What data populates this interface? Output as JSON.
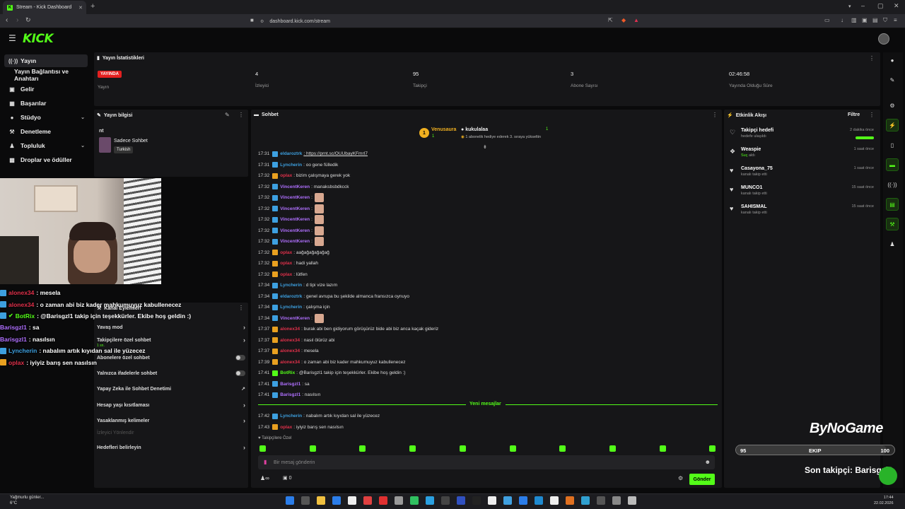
{
  "browser": {
    "tab_title": "Stream - Kick Dashboard",
    "url": "dashboard.kick.com/stream"
  },
  "app": {
    "logo": "KICK"
  },
  "nav": {
    "items": [
      {
        "label": "Yayın",
        "icon": "broadcast-icon"
      },
      {
        "label": "Yayın Bağlantısı ve Anahtarı",
        "icon": "link-icon"
      },
      {
        "label": "Gelir",
        "icon": "wallet-icon"
      },
      {
        "label": "Başarılar",
        "icon": "achievement-icon"
      },
      {
        "label": "Stüdyo",
        "icon": "studio-icon"
      },
      {
        "label": "Denetleme",
        "icon": "moderation-icon"
      },
      {
        "label": "Topluluk",
        "icon": "community-icon"
      },
      {
        "label": "Droplar ve ödüller",
        "icon": "gift-icon"
      }
    ]
  },
  "stats": {
    "title": "Yayın İstatistikleri",
    "live_badge": "YAYINDA",
    "items": [
      {
        "value": "",
        "label": "Yayın"
      },
      {
        "value": "4",
        "label": "İzleyici"
      },
      {
        "value": "95",
        "label": "Takipçi"
      },
      {
        "value": "3",
        "label": "Abone Sayısı"
      },
      {
        "value": "02:46:58",
        "label": "Yayında Olduğu Süre"
      }
    ]
  },
  "stream_info": {
    "title": "Yayın bilgisi",
    "stream_title": "nt",
    "category": "Sadece Sohbet",
    "language": "Turkish"
  },
  "overlay_chat": [
    {
      "user": "alonex34",
      "text": ": mesela",
      "color": "#e0304a"
    },
    {
      "user": "alonex34",
      "text": ": o zaman abi biz kader mahkumuyuz kabullenecez",
      "color": "#e0304a"
    },
    {
      "user": "BotRix",
      "text": ": @Barisgzl1 takip için teşekkürler. Ekibe hoş geldin :)",
      "color": "#53fc18"
    },
    {
      "user": "Barisgzl1",
      "text": ": sa",
      "color": "#b070ff"
    },
    {
      "user": "Barisgzl1",
      "text": ": nasılsın",
      "color": "#b070ff"
    },
    {
      "user": "Lyncherin",
      "text": ": nabalım artık kıyıdan sal ile yüzecez",
      "color": "#3da0e0"
    },
    {
      "user": "oplax",
      "text": ": iyiyiz barış sen nasılsın",
      "color": "#e0304a"
    }
  ],
  "channel_actions": {
    "title": "Kanal Eylemleri",
    "items": [
      {
        "label": "Yavaş mod",
        "control": "›"
      },
      {
        "label": "Takipçilere özel sohbet",
        "control": "›",
        "sub": "1 sn."
      },
      {
        "label": "Abonelere özel sohbet",
        "control": "toggle"
      },
      {
        "label": "Yalnızca ifadelerle sohbet",
        "control": "toggle"
      },
      {
        "label": "Yapay Zeka ile Sohbet Denetimi",
        "control": "↗"
      },
      {
        "label": "Hesap yaşı kısıtlaması",
        "control": "›"
      },
      {
        "label": "Yasaklanmış kelimeler",
        "control": "›"
      },
      {
        "label": "İzleyici Yönlendir",
        "control": ""
      },
      {
        "label": "Hedefleri belirleyin",
        "control": "›"
      }
    ]
  },
  "chat": {
    "title": "Sohbet",
    "pinned": {
      "user1": "Venusaura",
      "user1_count": "1",
      "user2": "kukulalaa",
      "user2_count": "1",
      "note": "1 abonelik hediye ederek 3. sıraya yükseltin"
    },
    "messages": [
      {
        "time": "17:31",
        "user": "eldaroztrk",
        "text": ": https://prnt.sc/OUUbayKFmrI7",
        "color": "#3da0e0"
      },
      {
        "time": "17:31",
        "user": "Lyncherin",
        "text": ": oo gene fülledik",
        "color": "#3da0e0"
      },
      {
        "time": "17:32",
        "user": "oplax",
        "text": ": bizim çalışmaya gerek yok",
        "color": "#e0304a"
      },
      {
        "time": "17:32",
        "user": "VincentKeren",
        "text": ": manaksbsbdkcck",
        "color": "#b070ff"
      },
      {
        "time": "17:32",
        "user": "VincentKeren",
        "text": ":",
        "color": "#b070ff",
        "emote": true
      },
      {
        "time": "17:32",
        "user": "VincentKeren",
        "text": ":",
        "color": "#b070ff",
        "emote": true
      },
      {
        "time": "17:32",
        "user": "VincentKeren",
        "text": ":",
        "color": "#b070ff",
        "emote": true
      },
      {
        "time": "17:32",
        "user": "VincentKeren",
        "text": ":",
        "color": "#b070ff",
        "emote": true
      },
      {
        "time": "17:32",
        "user": "VincentKeren",
        "text": ":",
        "color": "#b070ff",
        "emote": true
      },
      {
        "time": "17:32",
        "user": "oplax",
        "text": ": aağağağağağağ",
        "color": "#e0304a"
      },
      {
        "time": "17:32",
        "user": "oplax",
        "text": ": hadi yallah",
        "color": "#e0304a"
      },
      {
        "time": "17:32",
        "user": "oplax",
        "text": ": lütfen",
        "color": "#e0304a"
      },
      {
        "time": "17:34",
        "user": "Lyncherin",
        "text": ": d tipi vize lazım",
        "color": "#3da0e0"
      },
      {
        "time": "17:34",
        "user": "eldaroztrk",
        "text": ": genel avrupa bu şekilde almanca fransızca oynuyo",
        "color": "#3da0e0"
      },
      {
        "time": "17:34",
        "user": "Lyncherin",
        "text": ": çalışma için",
        "color": "#3da0e0"
      },
      {
        "time": "17:34",
        "user": "VincentKeren",
        "text": ":",
        "color": "#b070ff",
        "emote": true
      },
      {
        "time": "17:37",
        "user": "alonex34",
        "text": ": burak abi ben gidiyorum görüşürüz bide abi biz anca kaçak gideriz",
        "color": "#e0304a"
      },
      {
        "time": "17:37",
        "user": "alonex34",
        "text": ": nasıl ölürüz abi",
        "color": "#e0304a"
      },
      {
        "time": "17:37",
        "user": "alonex34",
        "text": ": mesela",
        "color": "#e0304a"
      },
      {
        "time": "17:39",
        "user": "alonex34",
        "text": ": o zaman abi biz kader mahkumuyuz kabullenecez",
        "color": "#e0304a"
      },
      {
        "time": "17:41",
        "user": "BotRix",
        "text": ": @Barisgzl1 takip için teşekkürler. Ekibe hoş geldin :)",
        "color": "#53fc18"
      },
      {
        "time": "17:41",
        "user": "Barisgzl1",
        "text": ": sa",
        "color": "#b070ff"
      },
      {
        "time": "17:41",
        "user": "Barisgzl1",
        "text": ": nasılsın",
        "color": "#b070ff"
      }
    ],
    "new_messages_label": "Yeni mesajlar",
    "new_messages": [
      {
        "time": "17:42",
        "user": "Lyncherin",
        "text": ": nabalım artık kıyıdan sal ile yüzecez",
        "color": "#3da0e0"
      },
      {
        "time": "17:43",
        "user": "oplax",
        "text": ": iyiyiz barış sen nasılsın",
        "color": "#e0304a"
      }
    ],
    "followers_only": "Takipçilere Özel",
    "input_placeholder": "Bir mesaj gönderin",
    "send_label": "Gönder",
    "infinity": "∞",
    "count": "0"
  },
  "activity": {
    "title": "Etkinlik Akışı",
    "filter": "Filtre",
    "events": [
      {
        "name": "Takipçi hedefi",
        "desc": "hedefe ulaşıldı",
        "time": "2 dakika önce",
        "progress": 1
      },
      {
        "name": "Weaspie",
        "desc": "Suç",
        "desc2": "aldı",
        "time": "1 saat önce"
      },
      {
        "name": "Casayona_75",
        "desc": "kanalı takip etti",
        "time": "1 saat önce"
      },
      {
        "name": "MUNCO1",
        "desc": "kanalı takip etti",
        "time": "15 saat önce"
      },
      {
        "name": "SAHISMAL",
        "desc": "kanalı takip etti",
        "time": "15 saat önce"
      }
    ]
  },
  "overlay": {
    "brand": "ByNoGame",
    "ekip_left": "95",
    "ekip_label": "EKIP",
    "ekip_right": "100",
    "ekip_fraction": 0.95,
    "son_takipci": "Son takipçi: Barisgzl1"
  },
  "taskbar": {
    "weather_line1": "Yağmurlu günler...",
    "weather_line2": "6°C",
    "time": "17:44",
    "date": "22.02.2026"
  },
  "colors": {
    "accent": "#53fc18",
    "live": "#e32020"
  }
}
